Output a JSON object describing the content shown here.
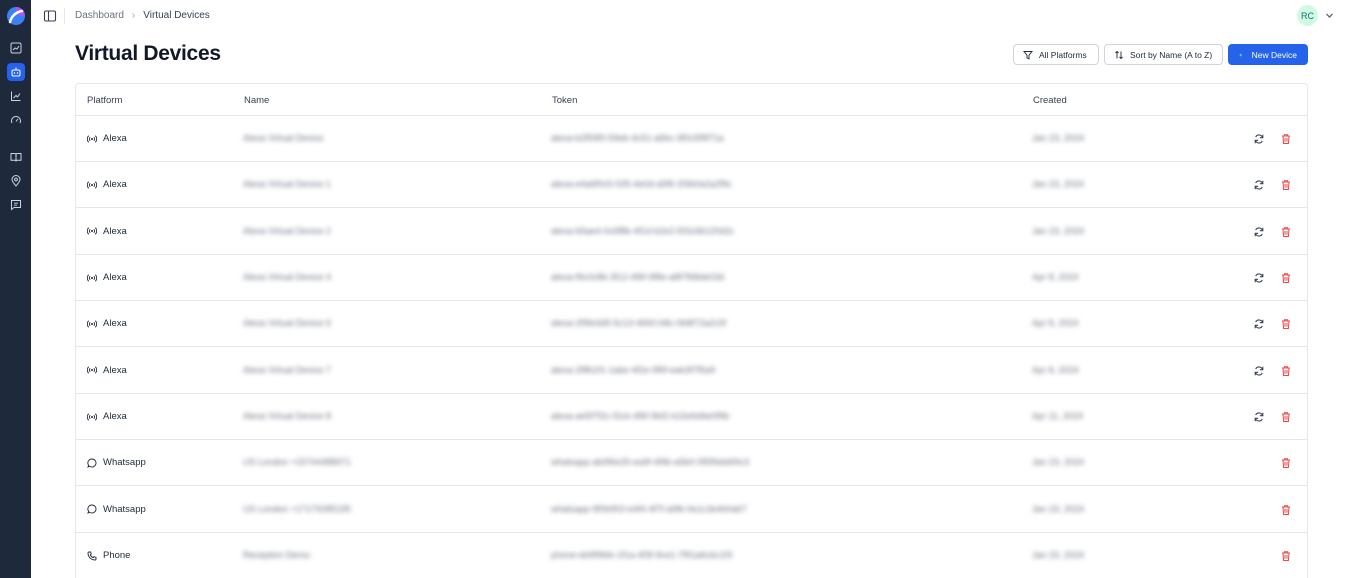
{
  "breadcrumb": {
    "home": "Dashboard",
    "current": "Virtual Devices"
  },
  "user": {
    "initials": "RC"
  },
  "page": {
    "title": "Virtual Devices"
  },
  "toolbar": {
    "filter_label": "All Platforms",
    "sort_label": "Sort by Name (A to Z)",
    "new_label": "New Device"
  },
  "table": {
    "headers": {
      "platform": "Platform",
      "name": "Name",
      "token": "Token",
      "created": "Created"
    },
    "rows": [
      {
        "platform": "Alexa",
        "icon": "broadcast-icon",
        "name": "Alexa Virtual Device",
        "token": "alexa-b2f59f0-59eb-4c51-a6bc-3f0c5f9f71a",
        "created": "Jan 23, 2024",
        "refresh": true
      },
      {
        "platform": "Alexa",
        "icon": "broadcast-icon",
        "name": "Alexa Virtual Device 1",
        "token": "alexa-e4a6f0c5-f1f5-4e0d-a5f6-2f3b0a2a2f9c",
        "created": "Jan 23, 2024",
        "refresh": true
      },
      {
        "platform": "Alexa",
        "icon": "broadcast-icon",
        "name": "Alexa Virtual Device 2",
        "token": "alexa-b5ae4-0c6f8b-4f1d-b2e2-5f1b36120d2c",
        "created": "Jan 23, 2024",
        "refresh": true
      },
      {
        "platform": "Alexa",
        "icon": "broadcast-icon",
        "name": "Alexa Virtual Device 4",
        "token": "alexa-f9c0c8b-3f12-4f6f-9f8e-a8f7f68de03d",
        "created": "Apr 8, 2024",
        "refresh": true
      },
      {
        "platform": "Alexa",
        "icon": "broadcast-icon",
        "name": "Alexa Virtual Device 6",
        "token": "alexa-2f9fe3d5-5c13-4660-b8c-0b8f72a2c0f",
        "created": "Apr 8, 2024",
        "refresh": true
      },
      {
        "platform": "Alexa",
        "icon": "broadcast-icon",
        "name": "Alexa Virtual Device 7",
        "token": "alexa-2f8b1f1-1abe-4f2e-9f6f-eab3f7f5a9",
        "created": "Apr 8, 2024",
        "refresh": true
      },
      {
        "platform": "Alexa",
        "icon": "broadcast-icon",
        "name": "Alexa Virtual Device 8",
        "token": "alexa-ae5f7f2c-f2cb-4f6f-9bf2-b15e6d6e0f9b",
        "created": "Apr 11, 2024",
        "refresh": true
      },
      {
        "platform": "Whatsapp",
        "icon": "chat-bubble-icon",
        "name": "US London +15744488971",
        "token": "whatsapp-ab0f6e25-ea9f-4f9b-a5b0-0f5f9eb6f4c3",
        "created": "Jan 23, 2024",
        "refresh": false
      },
      {
        "platform": "Whatsapp",
        "icon": "chat-bubble-icon",
        "name": "US London +17179285195",
        "token": "whatsapp-9f0b9f1f-e4f4-4f7f-a9fb-0e1c3e4b0a67",
        "created": "Jan 23, 2024",
        "refresh": false
      },
      {
        "platform": "Phone",
        "icon": "phone-icon",
        "name": "Reception Demo",
        "token": "phone-eb9f9bfe-1f1a-4f3f-9ce1-7f91a6c6c1f3",
        "created": "Jan 23, 2024",
        "refresh": false
      }
    ]
  }
}
